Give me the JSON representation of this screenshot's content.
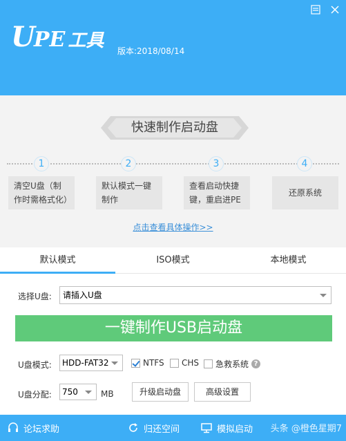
{
  "header": {
    "logo_u": "U",
    "logo_pe": "PE",
    "logo_tool": "工具",
    "version": "版本:2018/08/14",
    "window_icons": [
      "menu-icon",
      "close-icon"
    ]
  },
  "guide": {
    "banner": "快速制作启动盘",
    "steps": [
      {
        "num": "1",
        "text": "清空U盘（制作时需格式化）"
      },
      {
        "num": "2",
        "text": "默认模式一键制作"
      },
      {
        "num": "3",
        "text": "查看启动快捷键，重启进PE"
      },
      {
        "num": "4",
        "text": "还原系统"
      }
    ],
    "link": "点击查看具体操作>>"
  },
  "tabs": [
    "默认模式",
    "ISO模式",
    "本地模式"
  ],
  "form": {
    "select_usb_label": "选择U盘:",
    "select_usb_value": "请插入U盘",
    "make_button": "一键制作USB启动盘",
    "mode_label": "U盘模式:",
    "mode_value": "HDD-FAT32",
    "ntfs_label": "NTFS",
    "ntfs_checked": true,
    "chs_label": "CHS",
    "chs_checked": false,
    "rescue_label": "急救系统",
    "rescue_checked": false,
    "partition_label": "U盘分配:",
    "partition_value": "750",
    "partition_unit": "MB",
    "upgrade_button": "升级启动盘",
    "advanced_button": "高级设置"
  },
  "footer": {
    "forum": "论坛求助",
    "restore": "归还空间",
    "simulate": "模拟启动",
    "watermark": "头条 @橙色星期7"
  },
  "colors": {
    "primary": "#3daef6",
    "make_button": "#5fca7a",
    "guide_bg": "#f3f3f3"
  }
}
